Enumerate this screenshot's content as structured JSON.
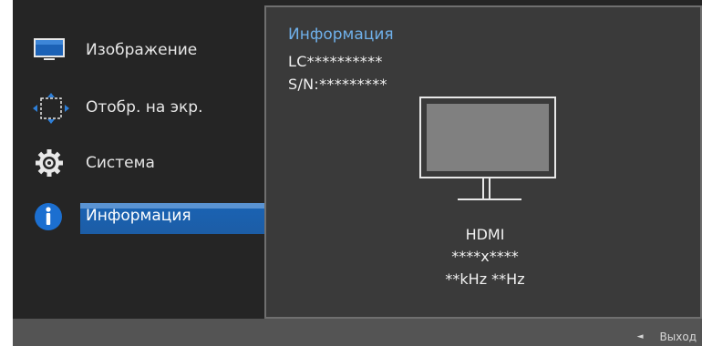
{
  "menu": {
    "items": [
      {
        "label": "Изображение",
        "icon": "picture-icon"
      },
      {
        "label": "Отобр. на экр.",
        "icon": "screen-adjust-icon"
      },
      {
        "label": "Система",
        "icon": "gear-icon"
      },
      {
        "label": "Информация",
        "icon": "info-icon",
        "selected": true
      }
    ]
  },
  "panel": {
    "title": "Информация",
    "model": "LC**********",
    "serial": "S/N:*********",
    "input": "HDMI",
    "resolution": "****x****",
    "frequency": "**kHz **Hz"
  },
  "footer": {
    "exit_label": "Выход"
  },
  "colors": {
    "accent": "#1a63b4",
    "title_blue": "#6fb0ea",
    "background": "#252525",
    "panel": "#3a3a3a"
  }
}
